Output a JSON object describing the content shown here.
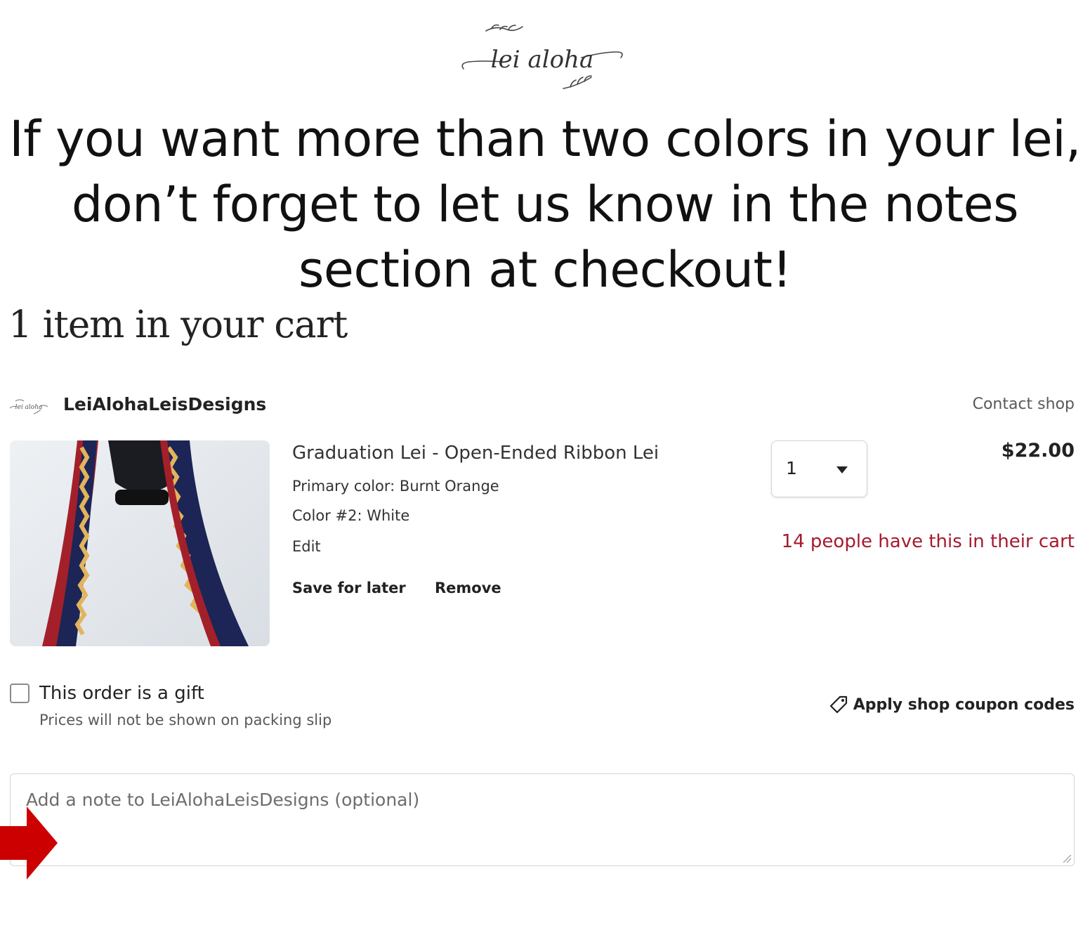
{
  "logo": {
    "text": "lei aloha"
  },
  "banner": {
    "headline": "If you want more than two colors in your lei, don’t forget to let us know in the notes section at checkout!"
  },
  "cart": {
    "count_text": "1 item in your cart"
  },
  "shop": {
    "name": "LeiAlohaLeisDesigns",
    "contact_label": "Contact shop"
  },
  "item": {
    "title": "Graduation Lei - Open-Ended Ribbon Lei",
    "variations": [
      "Primary color: Burnt Orange",
      "Color #2: White"
    ],
    "edit_label": "Edit",
    "save_for_later_label": "Save for later",
    "remove_label": "Remove",
    "quantity": "1",
    "price": "$22.00",
    "demand_text": "14 people have this in their cart",
    "image_colors": {
      "navy": "#1c2556",
      "red": "#a3202a",
      "gold": "#e2b45c",
      "background": "#e6eaee"
    }
  },
  "gift": {
    "label": "This order is a gift",
    "sublabel": "Prices will not be shown on packing slip",
    "checked": false
  },
  "coupon": {
    "label": "Apply shop coupon codes"
  },
  "note": {
    "placeholder": "Add a note to LeiAlohaLeisDesigns (optional)"
  },
  "colors": {
    "accent_red": "#a61a2e",
    "arrow_red": "#cc0000"
  }
}
